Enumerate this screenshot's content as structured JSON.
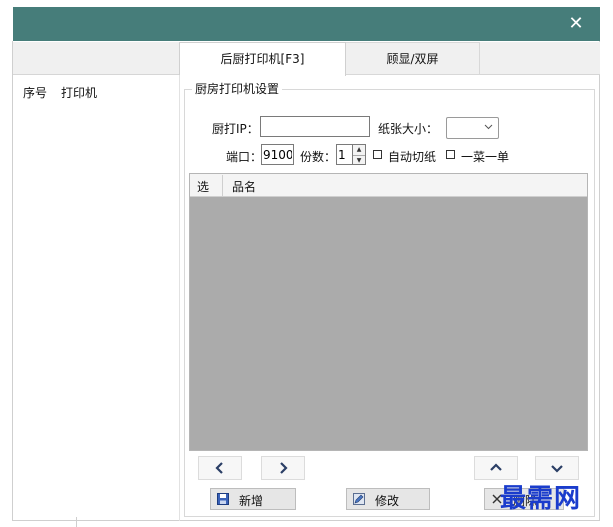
{
  "window": {
    "close_glyph": "✕"
  },
  "tabs": [
    {
      "label": "后厨打印机[F3]",
      "active": true
    },
    {
      "label": "顾显/双屏",
      "active": false
    }
  ],
  "left_list": {
    "columns": [
      "序号",
      "打印机"
    ]
  },
  "group": {
    "title": "厨房打印机设置"
  },
  "form": {
    "ip_label": "厨打IP：",
    "ip_value": "",
    "paper_label": "纸张大小：",
    "paper_value": "",
    "port_label": "端口：",
    "port_value": "9100",
    "copies_label": "份数：",
    "copies_value": "1",
    "auto_cut_label": "自动切纸",
    "auto_cut_checked": false,
    "one_dish_label": "一菜一单",
    "one_dish_checked": false
  },
  "grid": {
    "columns": [
      "选",
      "品名"
    ],
    "rows": []
  },
  "nav": {
    "prev_icon": "chevron-left-icon",
    "next_icon": "chevron-right-icon",
    "up_icon": "chevron-up-icon",
    "down_icon": "chevron-down-icon"
  },
  "actions": {
    "add_label": "新增",
    "edit_label": "修改",
    "delete_label": "删除"
  },
  "watermark": "最需网",
  "colors": {
    "titlebar": "#467d7a",
    "grid_bg": "#ababab",
    "watermark": "#1a3ccc"
  }
}
